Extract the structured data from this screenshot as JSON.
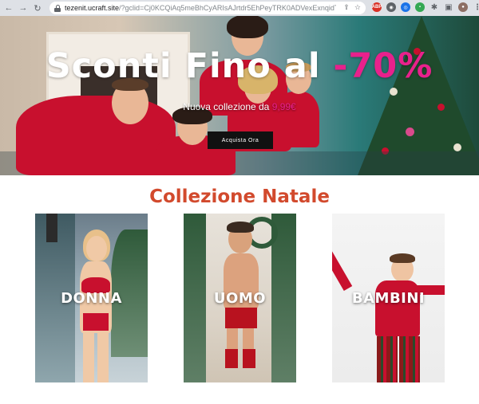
{
  "browser": {
    "url_host": "tezenit.ucraft.site",
    "url_path": "/?gclid=Cj0KCQiAq5meBhCyARIsAJrtdr5EhPeyTRK0ADVexExnqidTWVL6e_3Y6Dg...",
    "extensions": [
      "ABP"
    ]
  },
  "hero": {
    "title_main": "Sconti Fino al ",
    "title_discount": "-70%",
    "subtitle_text": "Nuova collezione da ",
    "subtitle_price": "9,99€",
    "cta_label": "Acquista Ora"
  },
  "collection": {
    "title": "Collezione Natale",
    "cards": [
      {
        "label": "DONNA"
      },
      {
        "label": "UOMO"
      },
      {
        "label": "BAMBINI"
      }
    ]
  },
  "colors": {
    "accent_pink": "#e8218c",
    "section_title": "#d24a2d",
    "cta_bg": "#111111"
  }
}
